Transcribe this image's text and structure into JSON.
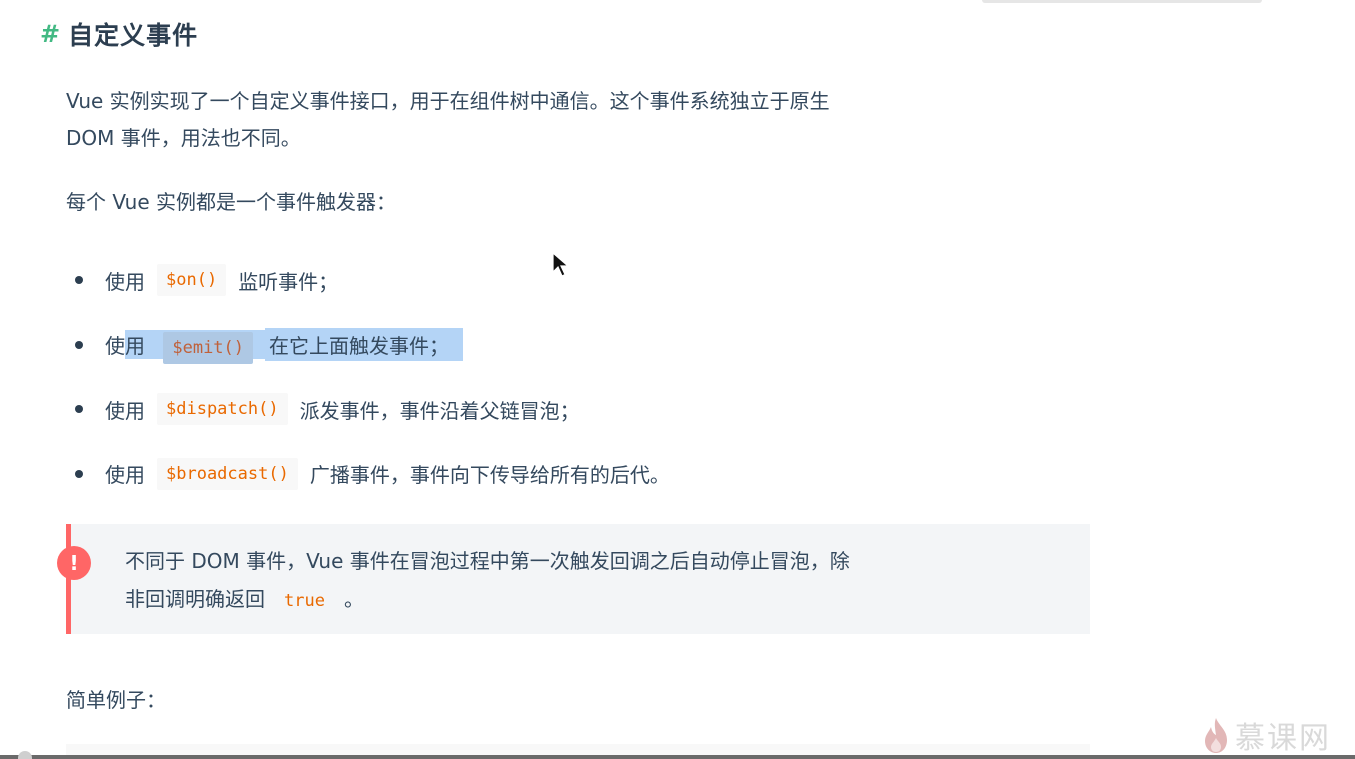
{
  "heading": {
    "hash": "#",
    "title": "自定义事件"
  },
  "intro": {
    "line1": "Vue 实例实现了一个自定义事件接口，用于在组件树中通信。这个事件系统独立于原生",
    "line2": "DOM 事件，用法也不同。"
  },
  "emitter_intro": "每个 Vue 实例都是一个事件触发器：",
  "bullets": [
    {
      "prefix": "使用",
      "code": "$on()",
      "suffix": "监听事件；"
    },
    {
      "prefix": "使",
      "prefix_highlighted": "用",
      "code": "$emit()",
      "suffix": "在它上面触发事件；"
    },
    {
      "prefix": "使用",
      "code": "$dispatch()",
      "suffix": "派发事件，事件沿着父链冒泡；"
    },
    {
      "prefix": "使用",
      "code": "$broadcast()",
      "suffix": "广播事件，事件向下传导给所有的后代。"
    }
  ],
  "tip": {
    "icon": "!",
    "line1": "不同于 DOM 事件，Vue 事件在冒泡过程中第一次触发回调之后自动停止冒泡，除",
    "line2_prefix": "非回调明确返回",
    "line2_code": "true",
    "line2_suffix": "。"
  },
  "example_label": "简单例子：",
  "watermark": {
    "text": "慕课网",
    "icon": "flame-logo-icon"
  },
  "colors": {
    "accent": "#42b983",
    "warning": "#ff6666",
    "code": "#e96900",
    "selection": "#b4d4f6"
  }
}
